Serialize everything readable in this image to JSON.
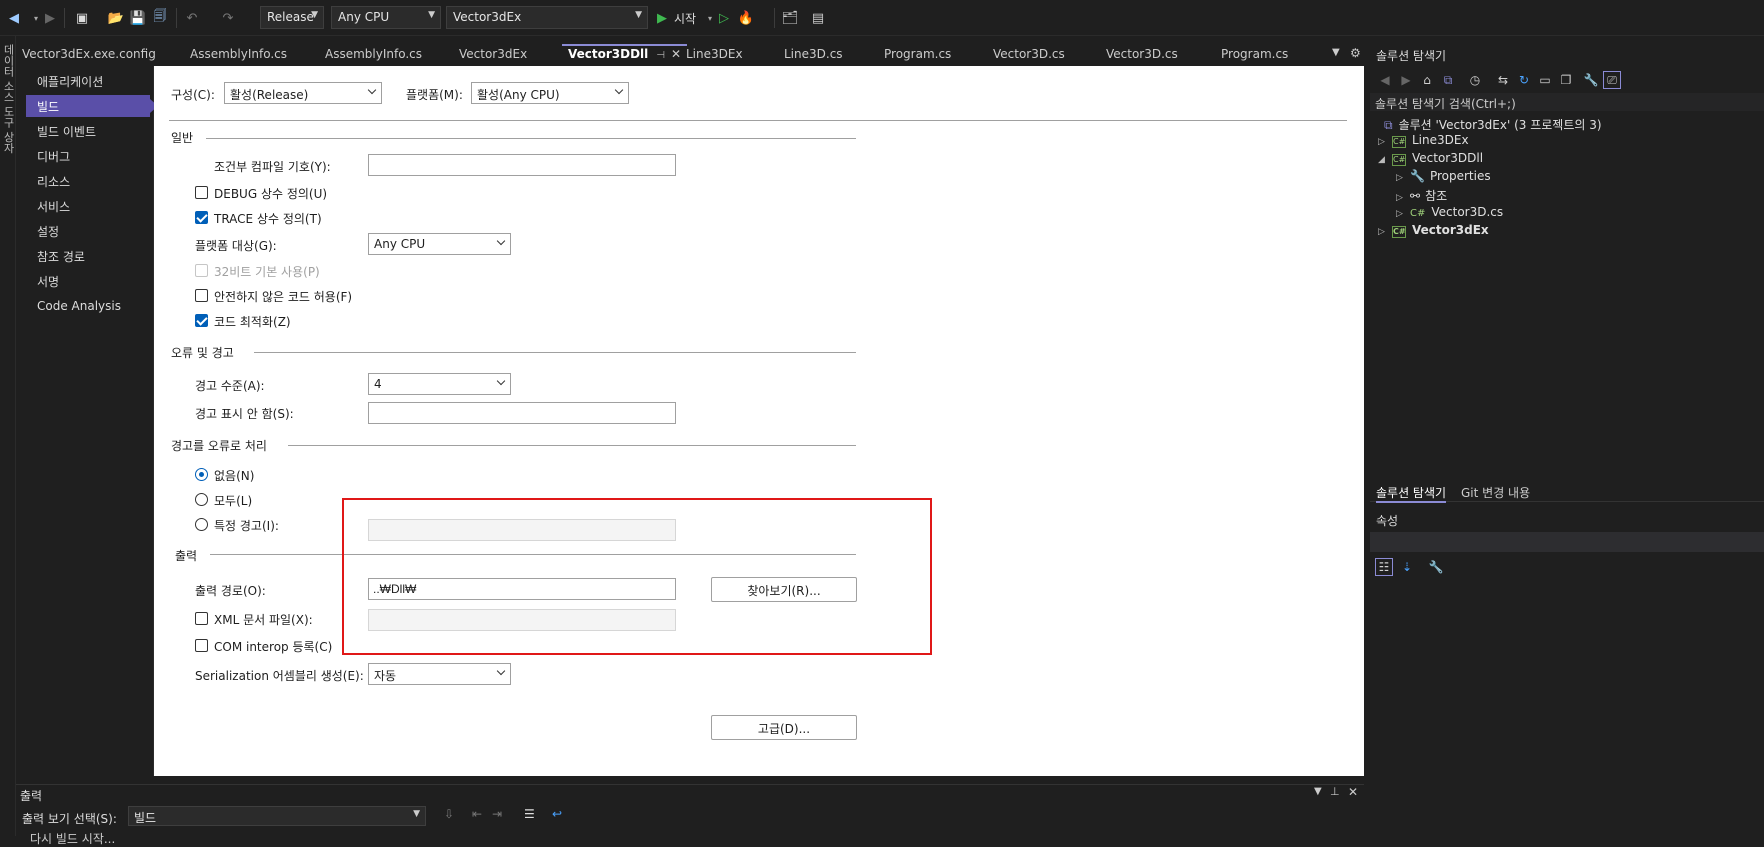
{
  "toolbar": {
    "config_value": "Release",
    "platform_value": "Any CPU",
    "startup_value": "Vector3dEx",
    "start_label": "시작",
    "colors": {
      "accent": "#5a4fa8",
      "start_green": "#3fb950"
    }
  },
  "left_strip": {
    "label": "데이터 소스   도구 상자"
  },
  "tabs": [
    {
      "label": "Vector3dEx.exe.config"
    },
    {
      "label": "AssemblyInfo.cs"
    },
    {
      "label": "AssemblyInfo.cs"
    },
    {
      "label": "Vector3dEx"
    },
    {
      "label": "Vector3DDll",
      "active": true
    },
    {
      "label": "Line3DEx"
    },
    {
      "label": "Line3D.cs"
    },
    {
      "label": "Program.cs"
    },
    {
      "label": "Vector3D.cs"
    },
    {
      "label": "Vector3D.cs"
    },
    {
      "label": "Program.cs"
    }
  ],
  "nav": {
    "items": [
      {
        "label": "애플리케이션"
      },
      {
        "label": "빌드"
      },
      {
        "label": "빌드 이벤트"
      },
      {
        "label": "디버그"
      },
      {
        "label": "리소스"
      },
      {
        "label": "서비스"
      },
      {
        "label": "설정"
      },
      {
        "label": "참조 경로"
      },
      {
        "label": "서명"
      },
      {
        "label": "Code Analysis"
      }
    ],
    "selected": "빌드"
  },
  "page": {
    "config_label": "구성(C):",
    "config_value": "활성(Release)",
    "platform_label": "플랫폼(M):",
    "platform_value": "활성(Any CPU)",
    "general": {
      "header": "일반",
      "cond_symbols_label": "조건부 컴파일 기호(Y):",
      "cond_symbols_value": "",
      "debug_label": "DEBUG 상수 정의(U)",
      "trace_label": "TRACE 상수 정의(T)",
      "platform_target_label": "플랫폼 대상(G):",
      "platform_target_value": "Any CPU",
      "prefer32_label": "32비트 기본 사용(P)",
      "unsafe_label": "안전하지 않은 코드 허용(F)",
      "optimize_label": "코드 최적화(Z)"
    },
    "errors": {
      "header": "오류 및 경고",
      "warn_level_label": "경고 수준(A):",
      "warn_level_value": "4",
      "suppress_label": "경고 표시 안 함(S):",
      "suppress_value": ""
    },
    "treat_warnings": {
      "header": "경고를 오류로 처리",
      "none_label": "없음(N)",
      "all_label": "모두(L)",
      "specific_label": "특정 경고(I):"
    },
    "output": {
      "header": "출력",
      "path_label": "출력 경로(O):",
      "path_value": "..₩Dll₩",
      "browse_label": "찾아보기(R)...",
      "xml_label": "XML 문서 파일(X):",
      "com_label": "COM interop 등록(C)",
      "serialization_label": "Serialization 어셈블리 생성(E):",
      "serialization_value": "자동",
      "advanced_label": "고급(D)..."
    }
  },
  "solution_explorer": {
    "title": "솔루션 탐색기",
    "search_placeholder": "솔루션 탐색기 검색(Ctrl+;)",
    "solution_label": "솔루션 'Vector3dEx'  (3 프로젝트의 3)",
    "items": [
      {
        "label": "Line3DEx"
      },
      {
        "label": "Vector3DDll"
      },
      {
        "label": "Properties"
      },
      {
        "label": "참조"
      },
      {
        "label": "Vector3D.cs"
      },
      {
        "label": "Vector3dEx"
      }
    ],
    "bottom_tab_active": "솔루션 탐색기",
    "bottom_tab_other": "Git 변경 내용",
    "properties_title": "속성"
  },
  "output_panel": {
    "title": "출력",
    "show_label": "출력 보기 선택(S):",
    "show_value": "빌드",
    "cut_text": "다시 빌드 시작..."
  }
}
